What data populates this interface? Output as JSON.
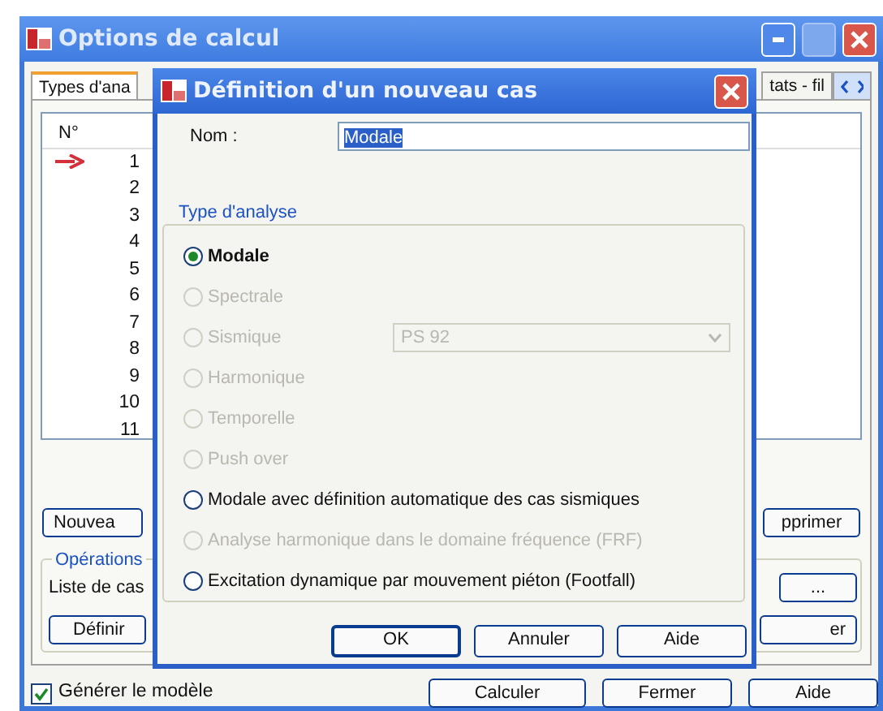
{
  "window": {
    "title": "Options de calcul"
  },
  "tabs": [
    {
      "label": "Types d'ana",
      "selected": true
    },
    {
      "label": "tats - fil",
      "selected": false
    }
  ],
  "cases_list": {
    "column_1": "N°",
    "rows": [
      {
        "number": "1",
        "current": true
      },
      {
        "number": "2",
        "current": false
      },
      {
        "number": "3",
        "current": false
      },
      {
        "number": "4",
        "current": false
      },
      {
        "number": "5",
        "current": false
      },
      {
        "number": "6",
        "current": false
      },
      {
        "number": "7",
        "current": false
      },
      {
        "number": "8",
        "current": false
      },
      {
        "number": "9",
        "current": false
      },
      {
        "number": "10",
        "current": false
      },
      {
        "number": "11",
        "current": false
      }
    ]
  },
  "case_buttons": [
    "Nouvea",
    "pprimer"
  ],
  "operations": {
    "title": "Opérations",
    "list_label": "Liste de cas",
    "browse_button": "...",
    "buttons": [
      "Définir",
      "er"
    ]
  },
  "generate_model": {
    "label": "Générer le modèle",
    "checked": true
  },
  "footer_buttons": [
    "Calculer",
    "Fermer",
    "Aide"
  ],
  "dialog": {
    "title": "Définition d'un nouveau cas",
    "name_label": "Nom :",
    "name_value": "Modale",
    "name_value_selected": true,
    "group_title": "Type d'analyse",
    "options": [
      {
        "label": "Modale",
        "selected": true,
        "disabled": false
      },
      {
        "label": "Spectrale",
        "selected": false,
        "disabled": true
      },
      {
        "label": "Sismique",
        "selected": false,
        "disabled": true,
        "combo": {
          "value": "PS 92",
          "disabled": true
        }
      },
      {
        "label": "Harmonique",
        "selected": false,
        "disabled": true
      },
      {
        "label": "Temporelle",
        "selected": false,
        "disabled": true
      },
      {
        "label": "Push over",
        "selected": false,
        "disabled": true
      },
      {
        "label": "Modale avec définition automatique des cas sismiques",
        "selected": false,
        "disabled": false
      },
      {
        "label": "Analyse harmonique dans le domaine fréquence (FRF)",
        "selected": false,
        "disabled": true
      },
      {
        "label": "Excitation dynamique par mouvement piéton (Footfall)",
        "selected": false,
        "disabled": false
      }
    ],
    "buttons": [
      {
        "label": "OK",
        "default": true
      },
      {
        "label": "Annuler",
        "default": false
      },
      {
        "label": "Aide",
        "default": false
      }
    ]
  }
}
